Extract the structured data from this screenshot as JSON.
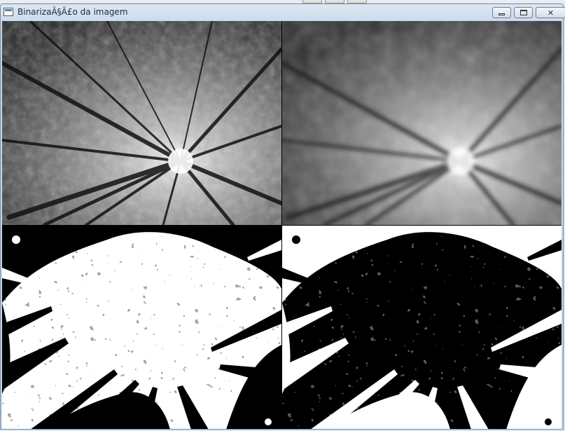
{
  "window": {
    "title": "BinarizaÃ§Ã£o da imagem",
    "controls": [
      "minimize-icon",
      "maximize-icon",
      "close-icon"
    ]
  },
  "panes": [
    {
      "name": "original-grayscale"
    },
    {
      "name": "blurred-grayscale"
    },
    {
      "name": "binary-threshold"
    },
    {
      "name": "binary-inverted"
    }
  ]
}
